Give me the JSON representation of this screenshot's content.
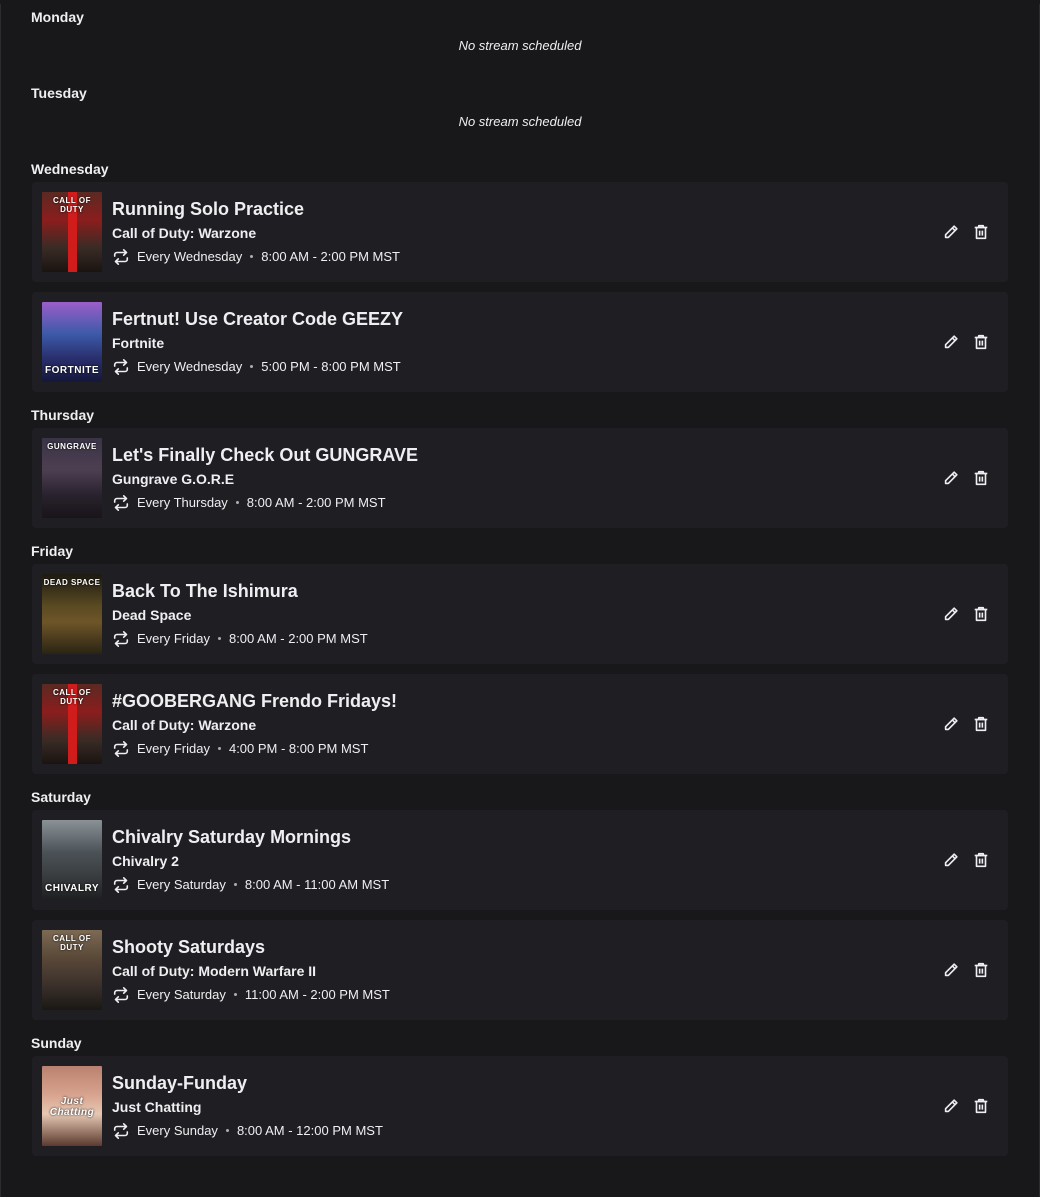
{
  "days": [
    {
      "label": "Monday",
      "empty_text": "No stream scheduled",
      "streams": []
    },
    {
      "label": "Tuesday",
      "empty_text": "No stream scheduled",
      "streams": []
    },
    {
      "label": "Wednesday",
      "streams": [
        {
          "title": "Running Solo Practice",
          "category": "Call of Duty: Warzone",
          "recurrence": "Every Wednesday",
          "time": "8:00 AM - 2:00 PM MST",
          "thumb": "cod",
          "thumb_text": "CALL OF DUTY"
        },
        {
          "title": "Fertnut! Use Creator Code GEEZY",
          "category": "Fortnite",
          "recurrence": "Every Wednesday",
          "time": "5:00 PM - 8:00 PM MST",
          "thumb": "fortnite",
          "thumb_text": "FORTNITE"
        }
      ]
    },
    {
      "label": "Thursday",
      "streams": [
        {
          "title": "Let's Finally Check Out GUNGRAVE",
          "category": "Gungrave G.O.R.E",
          "recurrence": "Every Thursday",
          "time": "8:00 AM - 2:00 PM MST",
          "thumb": "gungrave",
          "thumb_text": "GUNGRAVE"
        }
      ]
    },
    {
      "label": "Friday",
      "streams": [
        {
          "title": "Back To The Ishimura",
          "category": "Dead Space",
          "recurrence": "Every Friday",
          "time": "8:00 AM - 2:00 PM MST",
          "thumb": "deadspace",
          "thumb_text": "DEAD SPACE"
        },
        {
          "title": "#GOOBERGANG Frendo Fridays!",
          "category": "Call of Duty: Warzone",
          "recurrence": "Every Friday",
          "time": "4:00 PM - 8:00 PM MST",
          "thumb": "cod",
          "thumb_text": "CALL OF DUTY"
        }
      ]
    },
    {
      "label": "Saturday",
      "streams": [
        {
          "title": "Chivalry Saturday Mornings",
          "category": "Chivalry 2",
          "recurrence": "Every Saturday",
          "time": "8:00 AM - 11:00 AM MST",
          "thumb": "chivalry",
          "thumb_text": "CHIVALRY"
        },
        {
          "title": "Shooty Saturdays",
          "category": "Call of Duty: Modern Warfare II",
          "recurrence": "Every Saturday",
          "time": "11:00 AM - 2:00 PM MST",
          "thumb": "mw2",
          "thumb_text": "CALL OF DUTY"
        }
      ]
    },
    {
      "label": "Sunday",
      "streams": [
        {
          "title": "Sunday-Funday",
          "category": "Just Chatting",
          "recurrence": "Every Sunday",
          "time": "8:00 AM - 12:00 PM MST",
          "thumb": "chatting",
          "thumb_text": "Just Chatting"
        }
      ]
    }
  ],
  "icons": {
    "recurrence": "repeat-icon",
    "edit": "pencil-icon",
    "delete": "trash-icon"
  },
  "colors": {
    "background": "#18181b",
    "card": "#1f1f23",
    "text": "#efeff1"
  }
}
